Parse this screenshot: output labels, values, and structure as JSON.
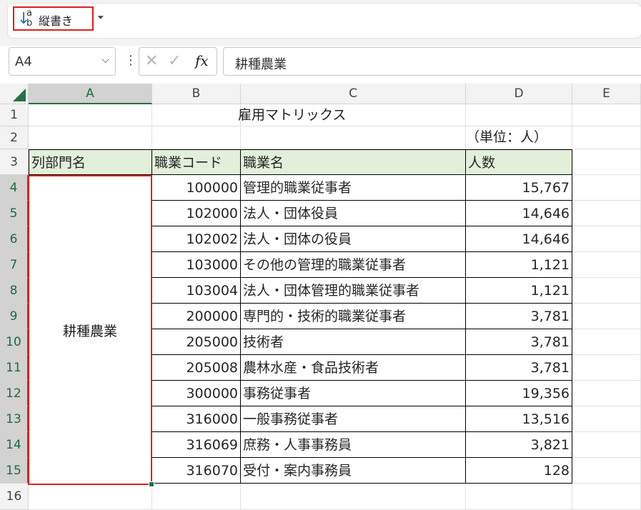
{
  "toolbar": {
    "orientation_button_label": "縦書き",
    "orientation_icon_letters": [
      "a",
      "b"
    ]
  },
  "formula_bar": {
    "name_box": "A4",
    "cancel_glyph": "✕",
    "enter_glyph": "✓",
    "fx_label": "fx",
    "formula_value": "耕種農業"
  },
  "colors": {
    "header_fill": "#e2efda",
    "selection_border": "#e0201a",
    "excel_green": "#217346"
  },
  "sheet": {
    "columns": [
      "A",
      "B",
      "C",
      "D",
      "E"
    ],
    "rows": [
      "1",
      "2",
      "3",
      "4",
      "5",
      "6",
      "7",
      "8",
      "9",
      "10",
      "11",
      "12",
      "13",
      "14",
      "15",
      "16"
    ],
    "title": "雇用マトリックス",
    "unit": "（単位：人）",
    "headers": [
      "列部門名",
      "職業コード",
      "職業名",
      "人数"
    ],
    "merged_category": "耕種農業",
    "data": [
      {
        "code": "100000",
        "name": "管理的職業従事者",
        "count": "15,767"
      },
      {
        "code": "102000",
        "name": "法人・団体役員",
        "count": "14,646"
      },
      {
        "code": "102002",
        "name": "法人・団体の役員",
        "count": "14,646"
      },
      {
        "code": "103000",
        "name": "その他の管理的職業従事者",
        "count": "1,121"
      },
      {
        "code": "103004",
        "name": "法人・団体管理的職業従事者",
        "count": "1,121"
      },
      {
        "code": "200000",
        "name": "専門的・技術的職業従事者",
        "count": "3,781"
      },
      {
        "code": "205000",
        "name": "技術者",
        "count": "3,781"
      },
      {
        "code": "205008",
        "name": "農林水産・食品技術者",
        "count": "3,781"
      },
      {
        "code": "300000",
        "name": "事務従事者",
        "count": "19,356"
      },
      {
        "code": "316000",
        "name": "一般事務従事者",
        "count": "13,516"
      },
      {
        "code": "316069",
        "name": "庶務・人事事務員",
        "count": "3,821"
      },
      {
        "code": "316070",
        "name": "受付・案内事務員",
        "count": "128"
      }
    ]
  }
}
